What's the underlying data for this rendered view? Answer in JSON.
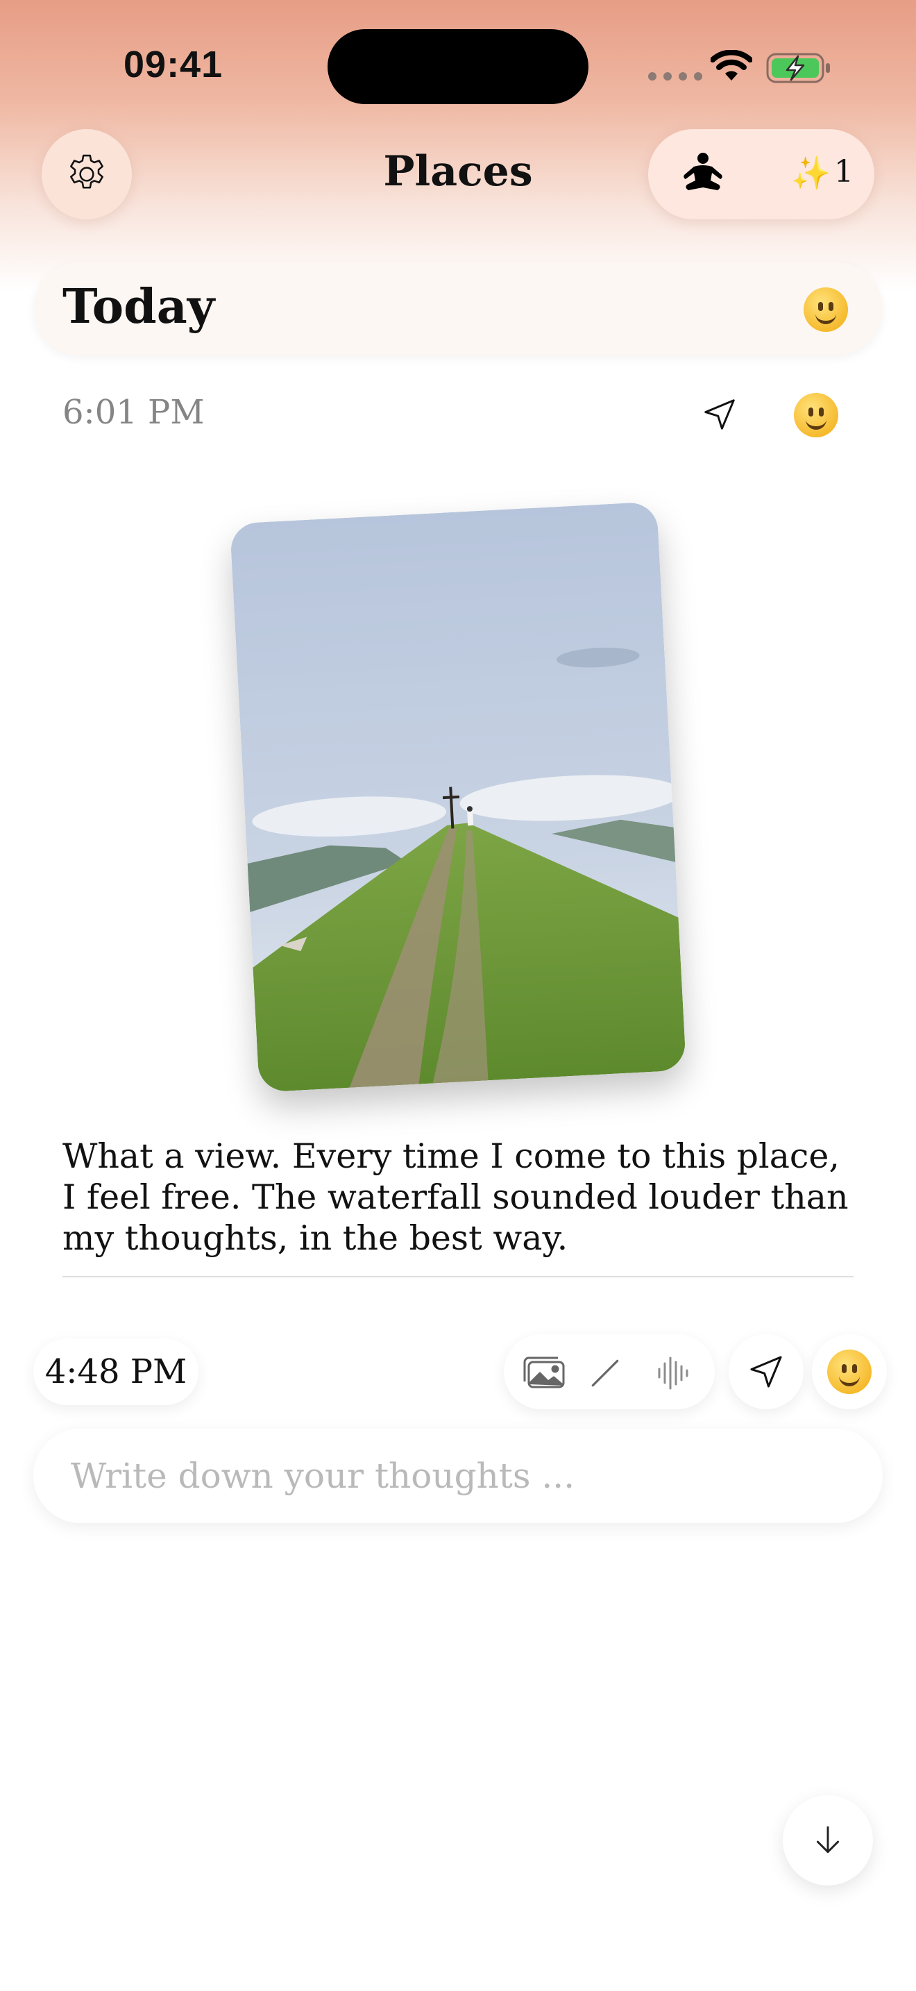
{
  "status_bar": {
    "time": "09:41"
  },
  "header": {
    "title": "Places",
    "sparkle": "✨",
    "sparkle_count": "1"
  },
  "day": {
    "label": "Today"
  },
  "entry": {
    "time": "6:01 PM",
    "text": "What a view. Every time I come to this place, I feel free. The waterfall sounded louder than my thoughts, in the best way."
  },
  "composer": {
    "time": "4:48 PM",
    "placeholder": "Write down your thoughts ...",
    "tools": [
      "photo-library-icon",
      "pencil-icon",
      "waveform-icon"
    ]
  },
  "icons": {
    "settings": "gear-icon",
    "mood": "smiley-icon",
    "location": "location-arrow-icon",
    "scroll": "arrow-down-icon"
  },
  "colors": {
    "header_gradient_top": "#e79d86",
    "accent_pill": "#fde7de",
    "battery_green": "#4cc85a"
  }
}
